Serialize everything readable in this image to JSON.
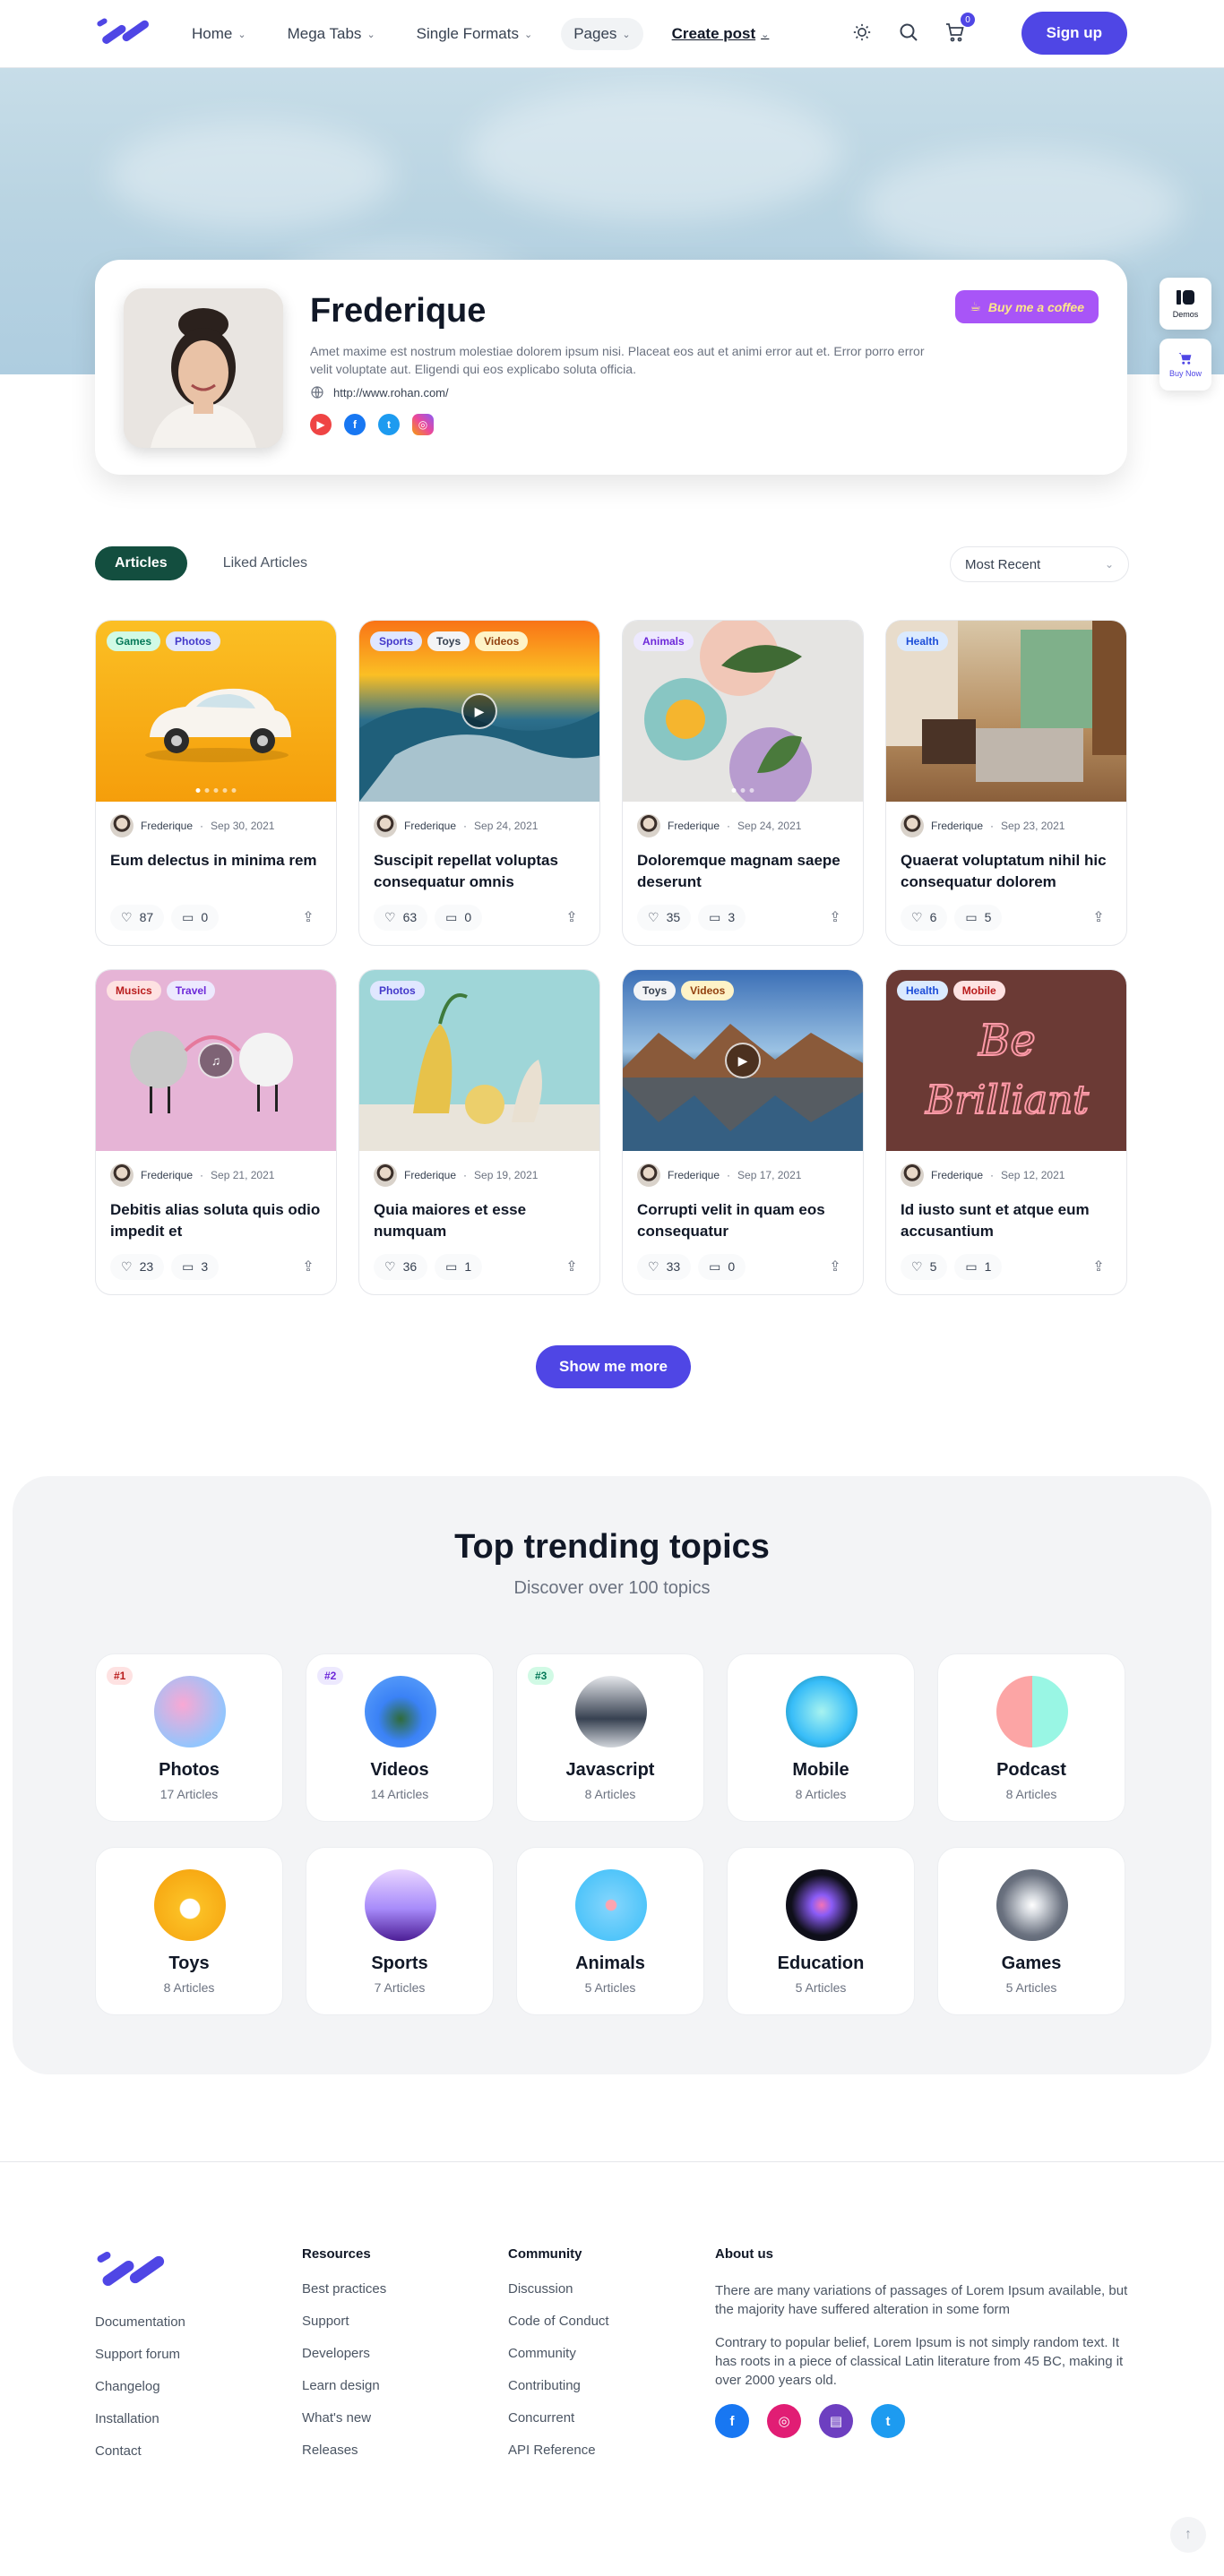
{
  "header": {
    "nav": [
      {
        "label": "Home",
        "active": false
      },
      {
        "label": "Mega Tabs",
        "active": false
      },
      {
        "label": "Single Formats",
        "active": false
      },
      {
        "label": "Pages",
        "active": true
      },
      {
        "label": "Create post",
        "active": false
      }
    ],
    "cart_count": "0",
    "signup_label": "Sign up"
  },
  "profile": {
    "name": "Frederique",
    "bio": "Amet maxime est nostrum molestiae dolorem ipsum nisi. Placeat eos aut et animi error aut et. Error porro error velit voluptate aut. Eligendi qui eos explicabo soluta officia.",
    "url": "http://www.rohan.com/",
    "coffee_label": "Buy me a coffee",
    "social": [
      "youtube-icon",
      "facebook-icon",
      "twitter-icon",
      "instagram-icon"
    ]
  },
  "side": {
    "demos_label": "Demos",
    "buy_label": "Buy Now"
  },
  "tabs": {
    "articles": "Articles",
    "liked": "Liked Articles",
    "sort": "Most Recent"
  },
  "articles": [
    {
      "tags": [
        "Games",
        "Photos"
      ],
      "author": "Frederique",
      "date": "Sep 30, 2021",
      "title": "Eum delectus in minima rem",
      "likes": "87",
      "comments": "0",
      "media": "gallery"
    },
    {
      "tags": [
        "Sports",
        "Toys",
        "Videos"
      ],
      "author": "Frederique",
      "date": "Sep 24, 2021",
      "title": "Suscipit repellat voluptas consequatur omnis",
      "likes": "63",
      "comments": "0",
      "media": "video"
    },
    {
      "tags": [
        "Animals"
      ],
      "author": "Frederique",
      "date": "Sep 24, 2021",
      "title": "Doloremque magnam saepe deserunt",
      "likes": "35",
      "comments": "3",
      "media": "gallery"
    },
    {
      "tags": [
        "Health"
      ],
      "author": "Frederique",
      "date": "Sep 23, 2021",
      "title": "Quaerat voluptatum nihil hic consequatur dolorem",
      "likes": "6",
      "comments": "5",
      "media": "image"
    },
    {
      "tags": [
        "Musics",
        "Travel"
      ],
      "author": "Frederique",
      "date": "Sep 21, 2021",
      "title": "Debitis alias soluta quis odio impedit et",
      "likes": "23",
      "comments": "3",
      "media": "audio"
    },
    {
      "tags": [
        "Photos"
      ],
      "author": "Frederique",
      "date": "Sep 19, 2021",
      "title": "Quia maiores et esse numquam",
      "likes": "36",
      "comments": "1",
      "media": "image"
    },
    {
      "tags": [
        "Toys",
        "Videos"
      ],
      "author": "Frederique",
      "date": "Sep 17, 2021",
      "title": "Corrupti velit in quam eos consequatur",
      "likes": "33",
      "comments": "0",
      "media": "video"
    },
    {
      "tags": [
        "Health",
        "Mobile"
      ],
      "author": "Frederique",
      "date": "Sep 12, 2021",
      "title": "Id iusto sunt et atque eum accusantium",
      "likes": "5",
      "comments": "1",
      "media": "image"
    }
  ],
  "show_more": "Show me more",
  "trending": {
    "title": "Top trending topics",
    "subtitle": "Discover over 100 topics",
    "topics": [
      {
        "rank": "#1",
        "name": "Photos",
        "count": "17 Articles"
      },
      {
        "rank": "#2",
        "name": "Videos",
        "count": "14 Articles"
      },
      {
        "rank": "#3",
        "name": "Javascript",
        "count": "8 Articles"
      },
      {
        "rank": "",
        "name": "Mobile",
        "count": "8 Articles"
      },
      {
        "rank": "",
        "name": "Podcast",
        "count": "8 Articles"
      },
      {
        "rank": "",
        "name": "Toys",
        "count": "8 Articles"
      },
      {
        "rank": "",
        "name": "Sports",
        "count": "7 Articles"
      },
      {
        "rank": "",
        "name": "Animals",
        "count": "5 Articles"
      },
      {
        "rank": "",
        "name": "Education",
        "count": "5 Articles"
      },
      {
        "rank": "",
        "name": "Games",
        "count": "5 Articles"
      }
    ]
  },
  "footer": {
    "links": [
      "Documentation",
      "Support forum",
      "Changelog",
      "Installation",
      "Contact"
    ],
    "resources": {
      "heading": "Resources",
      "items": [
        "Best practices",
        "Support",
        "Developers",
        "Learn design",
        "What's new",
        "Releases"
      ]
    },
    "community": {
      "heading": "Community",
      "items": [
        "Discussion",
        "Code of Conduct",
        "Community",
        "Contributing",
        "Concurrent",
        "API Reference"
      ]
    },
    "about": {
      "heading": "About us",
      "p1": "There are many variations of passages of Lorem Ipsum available, but the majority have suffered alteration in some form",
      "p2": "Contrary to popular belief, Lorem Ipsum is not simply random text. It has roots in a piece of classical Latin literature from 45 BC, making it over 2000 years old."
    }
  },
  "colors": {
    "accent": "#4f46e5",
    "tab_active": "#134e3f",
    "coffee": "#a855f7"
  }
}
